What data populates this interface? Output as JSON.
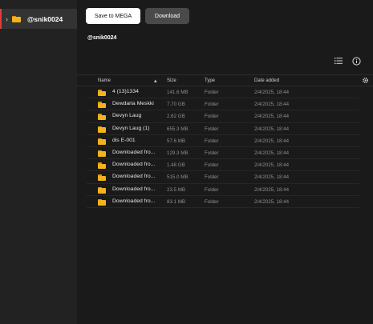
{
  "sidebar": {
    "root_label": "@snik0024",
    "chevron": "›"
  },
  "toolbar": {
    "save_label": "Save to MEGA",
    "download_label": "Download"
  },
  "breadcrumb": "@snik0024",
  "icons": {
    "list_view": "list-view-icon",
    "info": "info-icon",
    "settings": "gear-icon",
    "sort": "sort-asc-icon",
    "folder": "folder-icon"
  },
  "colors": {
    "folder": "#f4b21b",
    "accent": "#e23b3b",
    "save_button": "#ffffff",
    "download_button": "#4a4a4a"
  },
  "table": {
    "headers": {
      "name": "Name",
      "size": "Size",
      "type": "Type",
      "date": "Date added"
    },
    "sort_arrow": "▴",
    "rows": [
      {
        "name": "4 (13)1334",
        "size": "141.6 MB",
        "type": "Folder",
        "date": "2/4/2025, 18:44"
      },
      {
        "name": "Dewdaria Meskki",
        "size": "7.70 GB",
        "type": "Folder",
        "date": "2/4/2025, 18:44"
      },
      {
        "name": "Devyn Laug",
        "size": "2.62 GB",
        "type": "Folder",
        "date": "2/4/2025, 18:44"
      },
      {
        "name": "Devyn Laug (1)",
        "size": "655.3 MB",
        "type": "Folder",
        "date": "2/4/2025, 18:44"
      },
      {
        "name": "dis E-001",
        "size": "57.6 MB",
        "type": "Folder",
        "date": "2/4/2025, 18:44"
      },
      {
        "name": "Downloaded fro...",
        "size": "129.3 MB",
        "type": "Folder",
        "date": "2/4/2025, 18:44"
      },
      {
        "name": "Downloaded fro...",
        "size": "1.48 GB",
        "type": "Folder",
        "date": "2/4/2025, 18:44"
      },
      {
        "name": "Downloaded fro...",
        "size": "515.0 MB",
        "type": "Folder",
        "date": "2/4/2025, 18:44"
      },
      {
        "name": "Downloaded fro...",
        "size": "23.5 MB",
        "type": "Folder",
        "date": "2/4/2025, 18:44"
      },
      {
        "name": "Downloaded fro...",
        "size": "83.1 MB",
        "type": "Folder",
        "date": "2/4/2025, 18:44"
      }
    ]
  }
}
